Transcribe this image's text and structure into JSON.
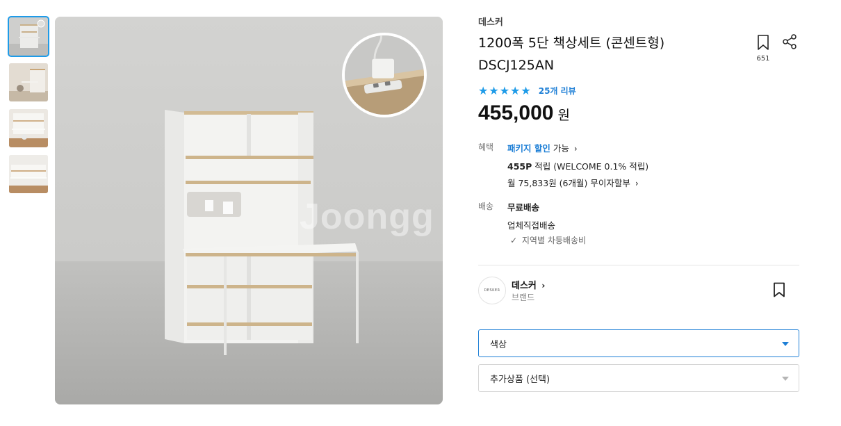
{
  "product": {
    "brand": "데스커",
    "title_line1": "1200폭 5단 책상세트 (콘센트형)",
    "title_line2": "DSCJ125AN",
    "bookmark_count": "651",
    "stars": "★★★★★",
    "review_count": "25개 리뷰",
    "price_number": "455,000",
    "price_unit": "원"
  },
  "image": {
    "watermark": "Joongg",
    "thumbnail_count": 4,
    "active_thumbnail": 0
  },
  "benefits": {
    "label": "혜택",
    "package_link": "패키지 할인",
    "package_suffix": "가능",
    "points_bold": "455P",
    "points_rest": "적립 (WELCOME 0.1% 적립)",
    "installment": "월 75,833원 (6개월) 무이자할부"
  },
  "shipping": {
    "label": "배송",
    "free": "무료배송",
    "method": "업체직접배송",
    "regional_check": "✓",
    "regional": "지역별 차등배송비"
  },
  "brand_card": {
    "logo_text": "DESKER",
    "name": "데스커",
    "subtitle": "브랜드"
  },
  "options": {
    "color_placeholder": "색상",
    "addon_placeholder": "추가상품 (선택)"
  },
  "colors": {
    "accent": "#1e9be8",
    "link": "#1e7fd6"
  }
}
